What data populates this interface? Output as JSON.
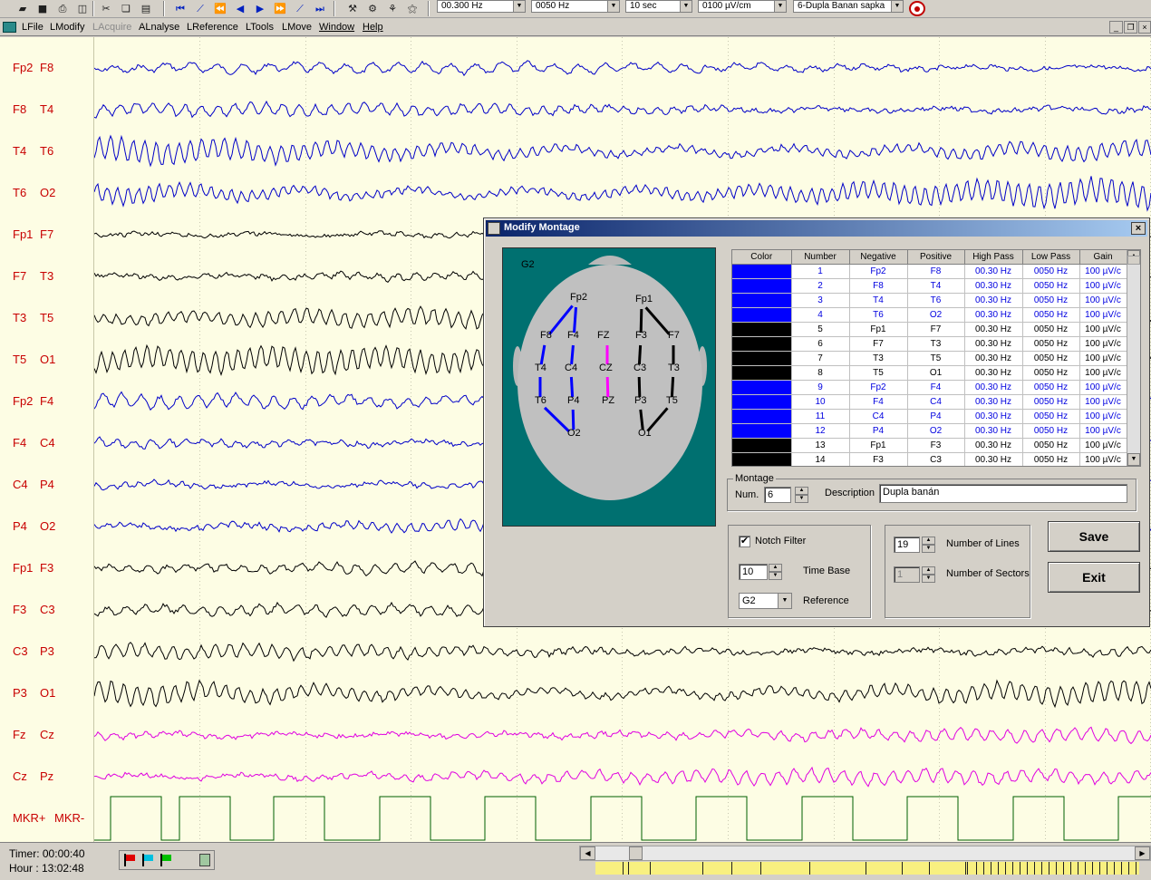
{
  "toolbar": {
    "combos": [
      "00.300 Hz",
      "0050 Hz",
      "10 sec",
      "0100 µV/cm",
      "6-Dupla Banan sapka"
    ]
  },
  "menu": {
    "items": [
      "LFile",
      "LModify",
      "LAcquire",
      "ALnalyse",
      "LReference",
      "LTools",
      "LMove",
      "Window",
      "Help"
    ],
    "mdi_buttons": [
      "_",
      "❐",
      "×"
    ]
  },
  "eeg": {
    "channels": [
      {
        "neg": "Fp2",
        "pos": "F8",
        "color": "#0000c8"
      },
      {
        "neg": "F8",
        "pos": "T4",
        "color": "#0000c8"
      },
      {
        "neg": "T4",
        "pos": "T6",
        "color": "#0000c8"
      },
      {
        "neg": "T6",
        "pos": "O2",
        "color": "#0000c8"
      },
      {
        "neg": "Fp1",
        "pos": "F7",
        "color": "#000000"
      },
      {
        "neg": "F7",
        "pos": "T3",
        "color": "#000000"
      },
      {
        "neg": "T3",
        "pos": "T5",
        "color": "#000000"
      },
      {
        "neg": "T5",
        "pos": "O1",
        "color": "#000000"
      },
      {
        "neg": "Fp2",
        "pos": "F4",
        "color": "#0000c8"
      },
      {
        "neg": "F4",
        "pos": "C4",
        "color": "#0000c8"
      },
      {
        "neg": "C4",
        "pos": "P4",
        "color": "#0000c8"
      },
      {
        "neg": "P4",
        "pos": "O2",
        "color": "#0000c8"
      },
      {
        "neg": "Fp1",
        "pos": "F3",
        "color": "#000000"
      },
      {
        "neg": "F3",
        "pos": "C3",
        "color": "#000000"
      },
      {
        "neg": "C3",
        "pos": "P3",
        "color": "#000000"
      },
      {
        "neg": "P3",
        "pos": "O1",
        "color": "#000000"
      },
      {
        "neg": "Fz",
        "pos": "Cz",
        "color": "#e000e0"
      },
      {
        "neg": "Cz",
        "pos": "Pz",
        "color": "#e000e0"
      },
      {
        "neg": "MKR+",
        "pos": "MKR-",
        "color": "#006000"
      }
    ]
  },
  "status": {
    "timer": "Timer: 00:00:40",
    "hour": "Hour  : 13:02:48",
    "flag_colors": [
      "#e00000",
      "#00c0e0",
      "#00c000"
    ]
  },
  "dialog": {
    "title": "Modify Montage",
    "reference_label": "G2",
    "electrodes": {
      "Fp2": "Fp2",
      "F8": "F8",
      "F4": "F4",
      "FZ": "FZ",
      "F3": "F3",
      "F7": "F7",
      "Fp1": "Fp1",
      "T4": "T4",
      "C4": "C4",
      "CZ": "CZ",
      "C3": "C3",
      "T3": "T3",
      "T6": "T6",
      "P4": "P4",
      "PZ": "PZ",
      "P3": "P3",
      "T5": "T5",
      "O2": "O2",
      "O1": "O1"
    },
    "table": {
      "headers": [
        "Color",
        "Number",
        "Negative",
        "Positive",
        "High Pass",
        "Low Pass",
        "Gain"
      ],
      "rows": [
        {
          "color": "#0000ff",
          "number": "1",
          "neg": "Fp2",
          "pos": "F8",
          "hp": "00.30 Hz",
          "lp": "0050 Hz",
          "gain": "100 µV/c"
        },
        {
          "color": "#0000ff",
          "number": "2",
          "neg": "F8",
          "pos": "T4",
          "hp": "00.30 Hz",
          "lp": "0050 Hz",
          "gain": "100 µV/c"
        },
        {
          "color": "#0000ff",
          "number": "3",
          "neg": "T4",
          "pos": "T6",
          "hp": "00.30 Hz",
          "lp": "0050 Hz",
          "gain": "100 µV/c"
        },
        {
          "color": "#0000ff",
          "number": "4",
          "neg": "T6",
          "pos": "O2",
          "hp": "00.30 Hz",
          "lp": "0050 Hz",
          "gain": "100 µV/c"
        },
        {
          "color": "#000000",
          "number": "5",
          "neg": "Fp1",
          "pos": "F7",
          "hp": "00.30 Hz",
          "lp": "0050 Hz",
          "gain": "100 µV/c"
        },
        {
          "color": "#000000",
          "number": "6",
          "neg": "F7",
          "pos": "T3",
          "hp": "00.30 Hz",
          "lp": "0050 Hz",
          "gain": "100 µV/c"
        },
        {
          "color": "#000000",
          "number": "7",
          "neg": "T3",
          "pos": "T5",
          "hp": "00.30 Hz",
          "lp": "0050 Hz",
          "gain": "100 µV/c"
        },
        {
          "color": "#000000",
          "number": "8",
          "neg": "T5",
          "pos": "O1",
          "hp": "00.30 Hz",
          "lp": "0050 Hz",
          "gain": "100 µV/c"
        },
        {
          "color": "#0000ff",
          "number": "9",
          "neg": "Fp2",
          "pos": "F4",
          "hp": "00.30 Hz",
          "lp": "0050 Hz",
          "gain": "100 µV/c"
        },
        {
          "color": "#0000ff",
          "number": "10",
          "neg": "F4",
          "pos": "C4",
          "hp": "00.30 Hz",
          "lp": "0050 Hz",
          "gain": "100 µV/c"
        },
        {
          "color": "#0000ff",
          "number": "11",
          "neg": "C4",
          "pos": "P4",
          "hp": "00.30 Hz",
          "lp": "0050 Hz",
          "gain": "100 µV/c"
        },
        {
          "color": "#0000ff",
          "number": "12",
          "neg": "P4",
          "pos": "O2",
          "hp": "00.30 Hz",
          "lp": "0050 Hz",
          "gain": "100 µV/c"
        },
        {
          "color": "#000000",
          "number": "13",
          "neg": "Fp1",
          "pos": "F3",
          "hp": "00.30 Hz",
          "lp": "0050 Hz",
          "gain": "100 µV/c"
        },
        {
          "color": "#000000",
          "number": "14",
          "neg": "F3",
          "pos": "C3",
          "hp": "00.30 Hz",
          "lp": "0050 Hz",
          "gain": "100 µV/c"
        }
      ]
    },
    "montage": {
      "group_title": "Montage",
      "num_label": "Num.",
      "num_value": "6",
      "description_label": "Description",
      "description_value": "Dupla banán"
    },
    "options": {
      "notch_label": "Notch Filter",
      "notch_checked": "✔",
      "time_base_value": "10",
      "time_base_label": "Time Base",
      "reference_value": "G2",
      "reference_label": "Reference",
      "lines_value": "19",
      "lines_label": "Number of Lines",
      "sectors_value": "1",
      "sectors_label": "Number of Sectors"
    },
    "buttons": {
      "save": "Save",
      "exit": "Exit",
      "close": "×"
    }
  }
}
